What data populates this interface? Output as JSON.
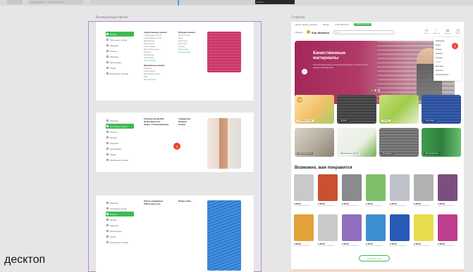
{
  "top_strip": {
    "tab2_text": "Главная десктоп · Каталог десктоп",
    "tab4_text": "Каталог"
  },
  "left_frame_label": "Выпадающее меню",
  "right_frame_label": "Главная",
  "desktop_label": "десктоп",
  "menu_sections": [
    {
      "sidebar": [
        {
          "label": "Шторы",
          "active": true
        },
        {
          "label": "Рулонные шторы",
          "active": false
        },
        {
          "label": "Жалюзи",
          "active": false
        },
        {
          "label": "Плиссе",
          "active": false
        },
        {
          "label": "Карнизы",
          "active": false
        },
        {
          "label": "Аксессуары",
          "active": false
        },
        {
          "label": "Ткани",
          "active": false
        },
        {
          "label": "Натяжные потолки",
          "active": false
        }
      ],
      "col1_head": "Горизонтальные жалюзи",
      "col1_items": [
        "Алюминиевые 16 мм",
        "Алюминиевые 25 мм",
        "Деревянные",
        "Бамбуковые",
        "Пластиковые",
        "Мультифактурные",
        "Изолайт",
        "Межрамные",
        "Аксессуары"
      ],
      "col1_more": "Все категории",
      "col1_head2": "Вертикальные жалюзи",
      "col1_items2": [
        "Тканевые",
        "Пластиковые",
        "Мультифактурные",
        "Арки"
      ],
      "col1_more2": "Все категории",
      "col2_head": "Рулонные жалюзи",
      "col2_items": [
        "Классические",
        "Мини",
        "Кассетные",
        "День-ночь",
        "Блэкаут",
        "Рольставни"
      ],
      "col2_more": "Все категории"
    },
    {
      "sidebar": [
        {
          "label": "Жалюзи",
          "active": false
        },
        {
          "label": "Рулонные шторы",
          "active": true
        },
        {
          "label": "Плиссе",
          "active": false
        },
        {
          "label": "Шторы",
          "active": false
        },
        {
          "label": "Карнизы",
          "active": false
        },
        {
          "label": "Аксессуары",
          "active": false
        },
        {
          "label": "Ткани",
          "active": false
        },
        {
          "label": "Натяжные потолки",
          "active": false
        }
      ],
      "col1_head": "Рулонные шторы Mini",
      "col1_items": [
        "Шторы День-ночь",
        "Шторы с электроприводом"
      ],
      "col2_head": "Стандартные",
      "col2_items": [
        "Премиум",
        "Блэкаут"
      ],
      "badge": "1"
    },
    {
      "sidebar": [
        {
          "label": "Жалюзи",
          "active": false
        },
        {
          "label": "Рулонные шторы",
          "active": false
        },
        {
          "label": "Плиссе",
          "active": true
        },
        {
          "label": "Шторы",
          "active": false
        },
        {
          "label": "Карнизы",
          "active": false
        },
        {
          "label": "Аксессуары",
          "active": false
        },
        {
          "label": "Ткани",
          "active": false
        },
        {
          "label": "Натяжные потолки",
          "active": false
        }
      ],
      "col1_head": "Плиссе стандартные",
      "col1_items": [
        "Плиссе день-ночь"
      ],
      "col2_head": "Шторы-гофре"
    }
  ],
  "site": {
    "topbar_items": [
      "Шторы, жалюзи, рулонные",
      "Москва",
      "+7 800 555-35-35"
    ],
    "topbar_button": "Заказать звонок",
    "catalog_button": "Каталог",
    "logo": "Sun Жалюзи",
    "search_placeholder": "Поиск",
    "header_icons": [
      {
        "icon": "user-icon",
        "glyph": "⚇",
        "label": "Войти"
      },
      {
        "icon": "heart-icon",
        "glyph": "♡",
        "label": "Избранное"
      },
      {
        "icon": "compare-icon",
        "glyph": "⚖",
        "label": "Сравнение"
      },
      {
        "icon": "cart-icon",
        "glyph": "🛒",
        "label": "Корзина"
      }
    ],
    "hero_title": "Качественные материалы",
    "hero_text": "Большой выбор тканей и материалов для жалюзи и рулонных штор от ведущих производителей.",
    "dropdown_items": [
      "Избранное",
      "Войти",
      "Каталог",
      "Заказать",
      "Корзина",
      "Акции",
      "Доставка",
      "Контакты",
      "Личный кабинет"
    ],
    "dropdown_badge": "1",
    "categories": [
      {
        "label": "Рулонные шторы",
        "promo": "-25%"
      },
      {
        "label": "Жалюзи"
      },
      {
        "label": "Плиссе"
      },
      {
        "label": "Рольставни"
      },
      {
        "label": "Горизонтальные"
      },
      {
        "label": "Вертикальные жалюзи"
      },
      {
        "label": "Межрамные"
      },
      {
        "label": "Электрокарнизы"
      }
    ],
    "section_title": "Возможно, вам понравится",
    "products": [
      {
        "price": "1 500 ₽",
        "color": "#c9c9c9"
      },
      {
        "price": "1 500 ₽",
        "color": "#c9512f"
      },
      {
        "price": "1 500 ₽",
        "color": "#8a8a8f"
      },
      {
        "price": "1 500 ₽",
        "color": "#7fbf6a"
      },
      {
        "price": "1 500 ₽",
        "color": "#bfc3c9"
      },
      {
        "price": "1 500 ₽",
        "color": "#b2b2b2"
      },
      {
        "price": "1 500 ₽",
        "color": "#7b4e7e"
      },
      {
        "price": "1 500 ₽",
        "color": "#e2a23a"
      },
      {
        "price": "1 500 ₽",
        "color": "#c9c9c9"
      },
      {
        "price": "1 500 ₽",
        "color": "#8f6fbf"
      },
      {
        "price": "1 500 ₽",
        "color": "#3e8fd0"
      },
      {
        "price": "1 500 ₽",
        "color": "#2a5ab8"
      },
      {
        "price": "1 500 ₽",
        "color": "#e8dc4a"
      },
      {
        "price": "1 500 ₽",
        "color": "#c03e8f"
      }
    ],
    "product_desc": "Рулонная штора Мини",
    "more_button": "Показать ещё"
  }
}
